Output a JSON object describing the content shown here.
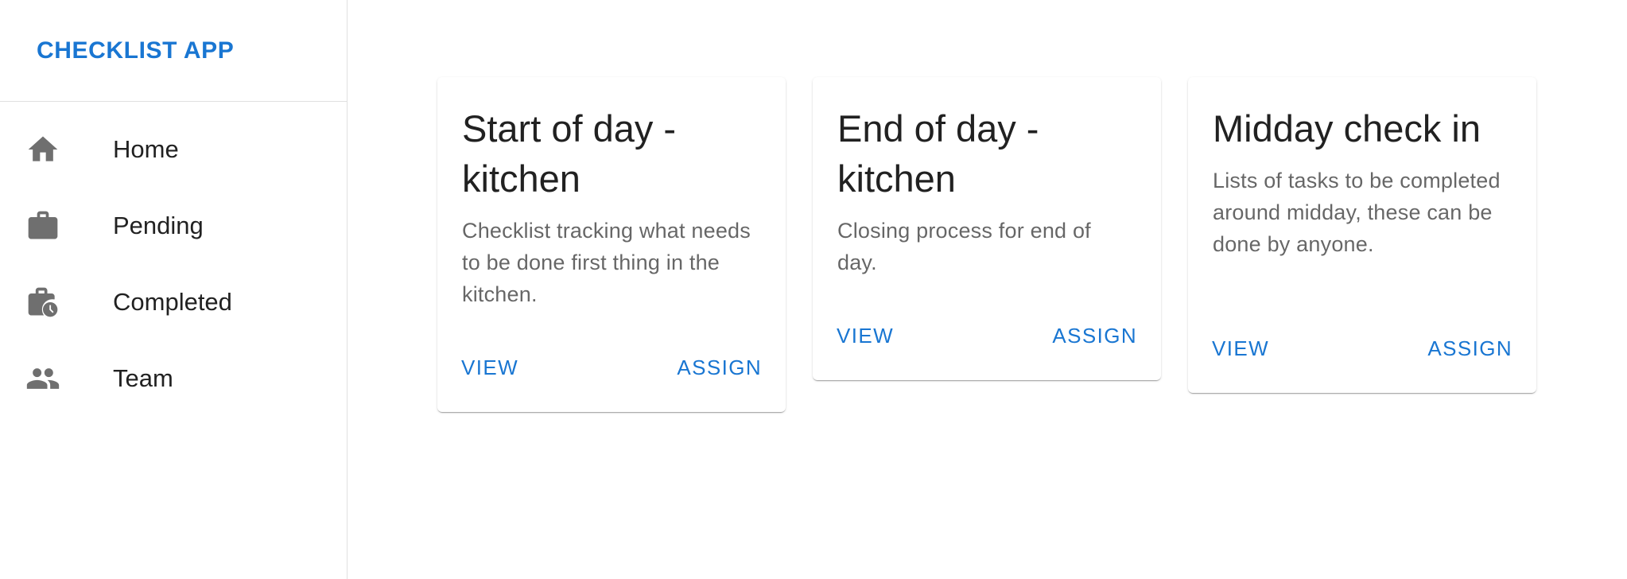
{
  "app": {
    "title": "CHECKLIST APP",
    "accent_color": "#1976d2"
  },
  "sidebar": {
    "items": [
      {
        "label": "Home",
        "icon": "home-icon"
      },
      {
        "label": "Pending",
        "icon": "briefcase-icon"
      },
      {
        "label": "Completed",
        "icon": "briefcase-clock-icon"
      },
      {
        "label": "Team",
        "icon": "people-icon"
      }
    ]
  },
  "cards": [
    {
      "title": "Start of day - kitchen",
      "description": "Checklist tracking what needs to be done first thing in the kitchen.",
      "view_label": "VIEW",
      "assign_label": "ASSIGN"
    },
    {
      "title": "End of day - kitchen",
      "description": "Closing process for end of day.",
      "view_label": "VIEW",
      "assign_label": "ASSIGN"
    },
    {
      "title": "Midday check in",
      "description": "Lists of tasks to be completed around midday, these can be done by anyone.",
      "view_label": "VIEW",
      "assign_label": "ASSIGN"
    }
  ]
}
